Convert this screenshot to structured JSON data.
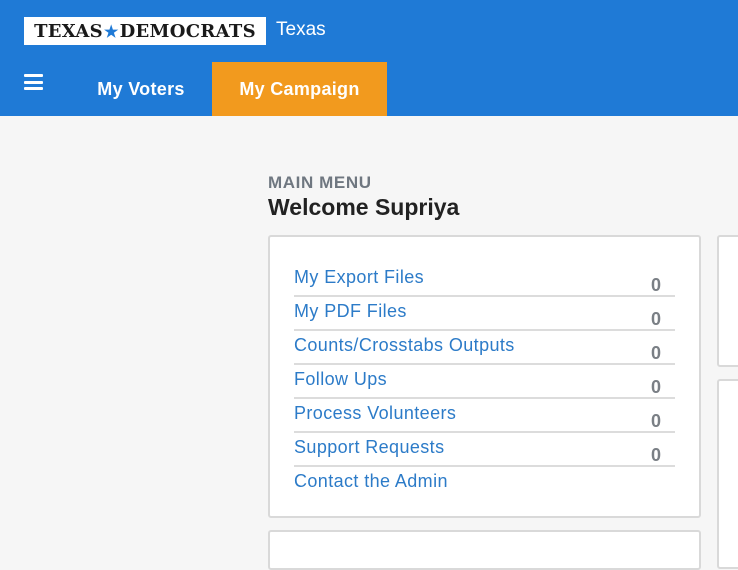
{
  "header": {
    "logo_text_left": "TEXAS",
    "logo_text_right": "DEMOCRATS",
    "state": "Texas",
    "tabs": [
      {
        "label": "My Voters",
        "active": false
      },
      {
        "label": "My Campaign",
        "active": true
      }
    ]
  },
  "main": {
    "eyebrow": "MAIN MENU",
    "welcome": "Welcome Supriya",
    "menu": [
      {
        "label": "My Export Files",
        "count": "0"
      },
      {
        "label": "My PDF Files",
        "count": "0"
      },
      {
        "label": "Counts/Crosstabs Outputs",
        "count": "0"
      },
      {
        "label": "Follow Ups",
        "count": "0"
      },
      {
        "label": "Process Volunteers",
        "count": "0"
      },
      {
        "label": "Support Requests",
        "count": "0"
      },
      {
        "label": "Contact the Admin"
      }
    ]
  },
  "colors": {
    "header_blue": "#1f7ad6",
    "active_tab_orange": "#f29a1e",
    "link_blue": "#2c7bc8"
  }
}
